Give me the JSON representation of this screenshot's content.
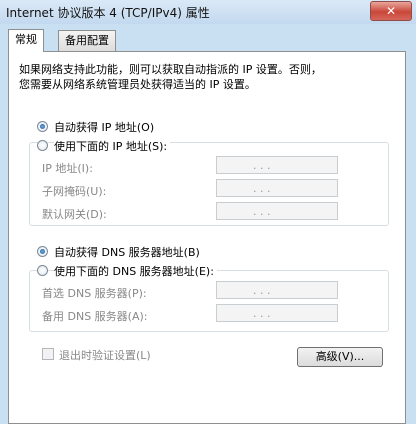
{
  "window": {
    "title": "Internet 协议版本 4 (TCP/IPv4) 属性",
    "close_glyph": "✕"
  },
  "tabs": [
    {
      "label": "常规",
      "active": true
    },
    {
      "label": "备用配置",
      "active": false
    }
  ],
  "description": {
    "line1": "如果网络支持此功能，则可以获取自动指派的 IP 设置。否则，",
    "line2": "您需要从网络系统管理员处获得适当的 IP 设置。"
  },
  "ip": {
    "auto_label": "自动获得 IP 地址(O)",
    "auto_selected": true,
    "manual_label": "使用下面的 IP 地址(S):",
    "fields": [
      {
        "label": "IP 地址(I):",
        "value": ". . ."
      },
      {
        "label": "子网掩码(U):",
        "value": ". . ."
      },
      {
        "label": "默认网关(D):",
        "value": ". . ."
      }
    ]
  },
  "dns": {
    "auto_label": "自动获得 DNS 服务器地址(B)",
    "auto_selected": true,
    "manual_label": "使用下面的 DNS 服务器地址(E):",
    "fields": [
      {
        "label": "首选 DNS 服务器(P):",
        "value": ". . ."
      },
      {
        "label": "备用 DNS 服务器(A):",
        "value": ". . ."
      }
    ]
  },
  "validate_checkbox": {
    "label": "退出时验证设置(L)",
    "checked": false
  },
  "advanced_button": {
    "label": "高级(V)..."
  }
}
